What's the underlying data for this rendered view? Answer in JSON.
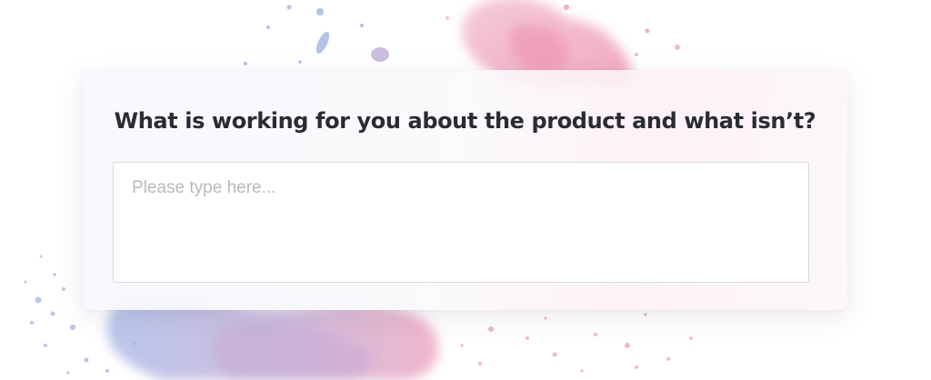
{
  "survey": {
    "question": "What is working for you about the product and what isn’t?",
    "answer_placeholder": "Please type here...",
    "answer_value": ""
  },
  "colors": {
    "splash_blue": "#a9b8e6",
    "splash_pink": "#ef9fba",
    "splash_lilac": "#c4b3da",
    "question_text": "#2b2b33",
    "field_border": "#d9d9de",
    "placeholder_text": "#b9b9be"
  }
}
